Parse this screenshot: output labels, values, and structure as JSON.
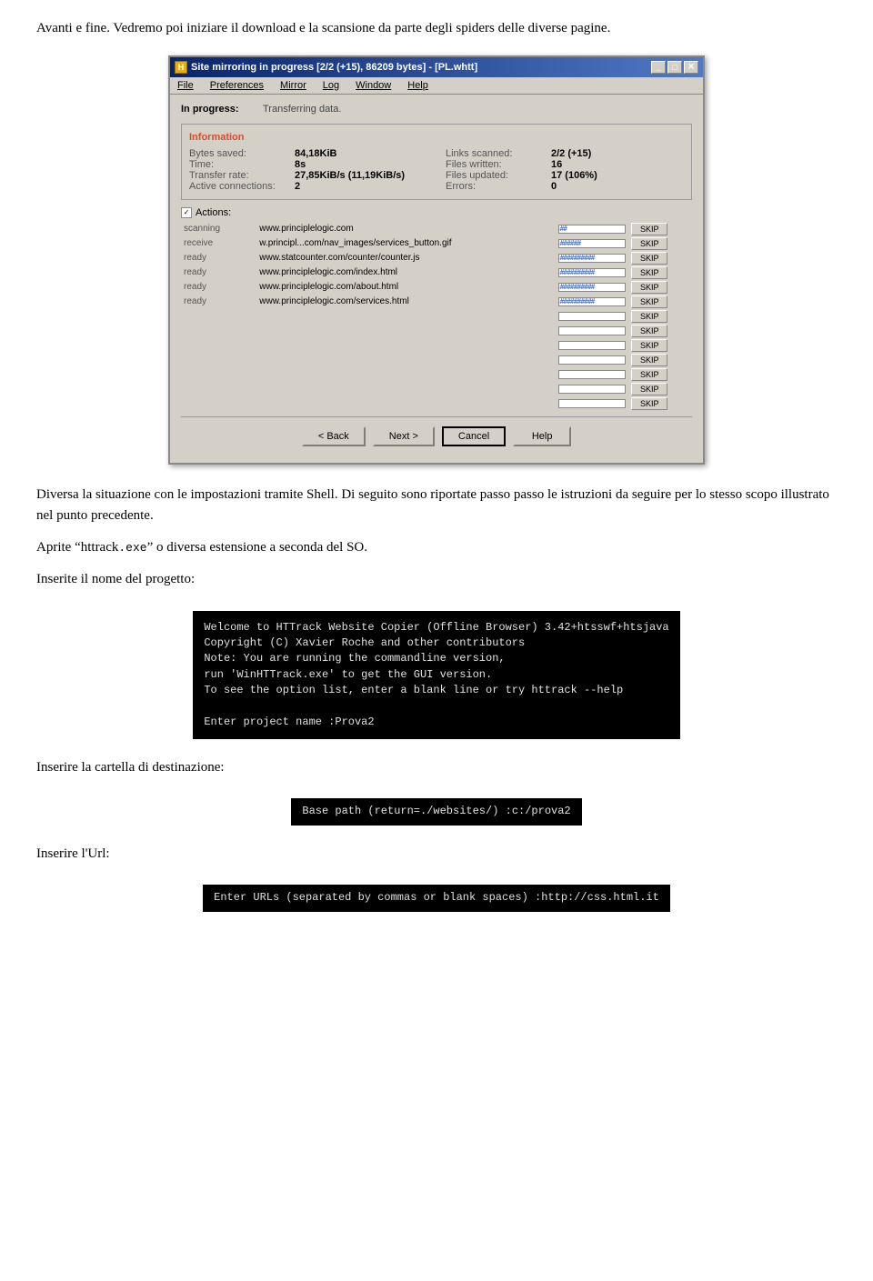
{
  "intro": {
    "para1": "Avanti e fine. Vedremo poi iniziare il download e la scansione da parte degli spiders delle diverse pagine."
  },
  "dialog": {
    "title": "Site mirroring in progress [2/2 (+15), 86209 bytes] - [PL.whtt]",
    "icon_letter": "H",
    "menu_items": [
      "File",
      "Preferences",
      "Mirror",
      "Log",
      "Window",
      "Help"
    ],
    "in_progress_label": "In progress:",
    "in_progress_value": "Transferring data.",
    "info_title": "Information",
    "info_rows_left": [
      {
        "key": "Bytes saved:",
        "val": "84,18KiB"
      },
      {
        "key": "Time:",
        "val": "8s"
      },
      {
        "key": "Transfer rate:",
        "val": "27,85KiB/s (11,19KiB/s)"
      },
      {
        "key": "Active connections:",
        "val": "2"
      }
    ],
    "info_rows_right": [
      {
        "key": "Links scanned:",
        "val": "2/2 (+15)"
      },
      {
        "key": "Files written:",
        "val": "16"
      },
      {
        "key": "Files updated:",
        "val": "17 (106%)"
      },
      {
        "key": "Errors:",
        "val": "0"
      }
    ],
    "actions_label": "Actions:",
    "table_rows": [
      {
        "status": "scanning",
        "url": "www.principlelogic.com",
        "prog_type": "short",
        "has_skip": true
      },
      {
        "status": "receive",
        "url": "w.principl...com/nav_images/services_button.gif",
        "prog_type": "full",
        "has_skip": true
      },
      {
        "status": "ready",
        "url": "www.statcounter.com/counter/counter.js",
        "prog_type": "full",
        "has_skip": true
      },
      {
        "status": "ready",
        "url": "www.principlelogic.com/index.html",
        "prog_type": "full",
        "has_skip": true
      },
      {
        "status": "ready",
        "url": "www.principlelogic.com/about.html",
        "prog_type": "full",
        "has_skip": true
      },
      {
        "status": "ready",
        "url": "www.principlelogic.com/services.html",
        "prog_type": "full",
        "has_skip": true
      },
      {
        "status": "",
        "url": "",
        "prog_type": "empty",
        "has_skip": true
      },
      {
        "status": "",
        "url": "",
        "prog_type": "empty",
        "has_skip": true
      },
      {
        "status": "",
        "url": "",
        "prog_type": "empty",
        "has_skip": true
      },
      {
        "status": "",
        "url": "",
        "prog_type": "empty",
        "has_skip": true
      },
      {
        "status": "",
        "url": "",
        "prog_type": "empty",
        "has_skip": true
      },
      {
        "status": "",
        "url": "",
        "prog_type": "empty",
        "has_skip": true
      },
      {
        "status": "",
        "url": "",
        "prog_type": "empty",
        "has_skip": true
      }
    ],
    "footer_buttons": [
      "< Back",
      "Next >",
      "Cancel",
      "Help"
    ]
  },
  "section2": {
    "para1": "Diversa la situazione con le impostazioni tramite Shell.",
    "para2": "Di seguito sono riportate passo passo le istruzioni da seguire per lo stesso scopo illustrato nel punto precedente.",
    "para3_prefix": "Aprite “httrack",
    "para3_code": ".exe",
    "para3_suffix": "” o diversa estensione a seconda del SO.",
    "para4": "Inserite il nome del progetto:"
  },
  "terminal1": {
    "line1": "Welcome to HTTrack Website Copier (Offline Browser) 3.42+htsswf+htsjava",
    "line2": "Copyright (C) Xavier Roche and other contributors",
    "line3": "Note: You are running the commandline version,",
    "line4": "run 'WinHTTrack.exe' to get the GUI version.",
    "line5": "To see the option list, enter a blank line or try httrack --help",
    "line6": "",
    "line7": "Enter project name :Prova2"
  },
  "section3": {
    "label": "Inserire la cartella di destinazione:"
  },
  "terminal2": {
    "text": "Base path (return=./websites/) :c:/prova2"
  },
  "section4": {
    "label": "Inserire l'Url:"
  },
  "terminal3": {
    "text": "Enter URLs (separated by commas or blank spaces) :http://css.html.it"
  }
}
